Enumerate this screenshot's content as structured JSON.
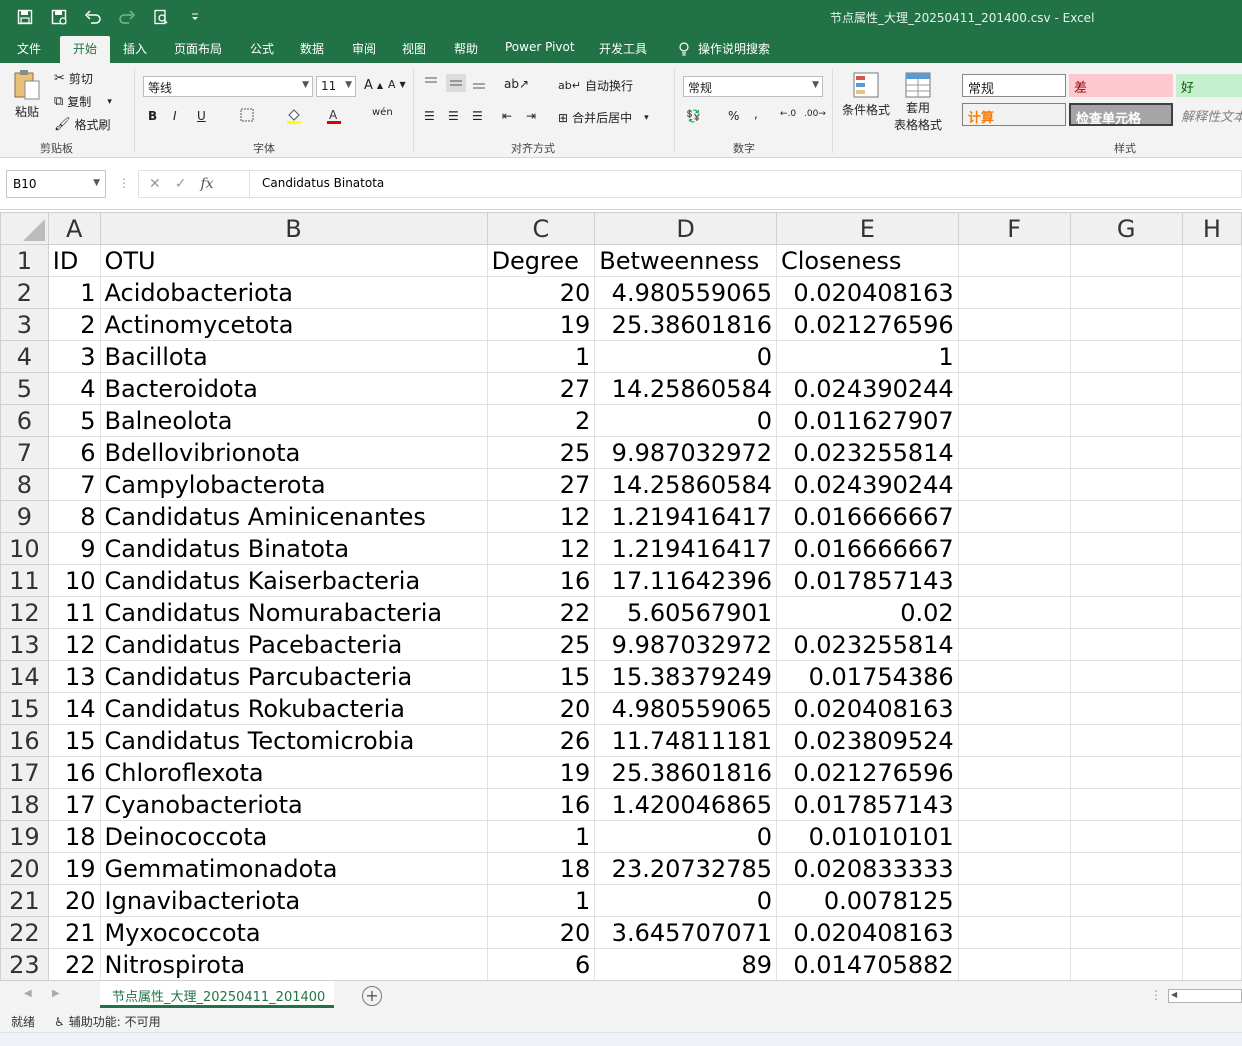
{
  "window": {
    "doc_title": "节点属性_大理_20250411_201400.csv  -  Excel"
  },
  "menu": {
    "items": [
      "文件",
      "开始",
      "插入",
      "页面布局",
      "公式",
      "数据",
      "审阅",
      "视图",
      "帮助",
      "Power Pivot",
      "开发工具",
      "操作说明搜索"
    ],
    "active": "开始"
  },
  "ribbon": {
    "clipboard": {
      "paste": "粘贴",
      "cut": "剪切",
      "copy": "复制",
      "format_painter": "格式刷",
      "label": "剪贴板"
    },
    "font": {
      "name": "等线",
      "size": "11",
      "label": "字体",
      "bold": "B",
      "italic": "I",
      "underline": "U"
    },
    "alignment": {
      "wrap": "自动换行",
      "merge": "合并后居中",
      "label": "对齐方式"
    },
    "number": {
      "format": "常规",
      "percent": "%",
      "comma": ",",
      "label": "数字"
    },
    "styles": {
      "conditional": "条件格式",
      "table_format_1": "套用",
      "table_format_2": "表格格式",
      "label": "样式",
      "normal": "常规",
      "bad": "差",
      "good": "好",
      "calc": "计算",
      "check": "检查单元格",
      "explain": "解释性文本"
    }
  },
  "formula_bar": {
    "name_box": "B10",
    "fx": "fx",
    "content": "Candidatus Binatota"
  },
  "columns": [
    "A",
    "B",
    "C",
    "D",
    "E",
    "F",
    "G",
    "H"
  ],
  "rows": [
    {
      "n": "1",
      "a": "ID",
      "b": "OTU",
      "c": "Degree",
      "d": "Betweenness",
      "e": "Closeness"
    },
    {
      "n": "2",
      "a": "1",
      "b": "Acidobacteriota",
      "c": "20",
      "d": "4.980559065",
      "e": "0.020408163"
    },
    {
      "n": "3",
      "a": "2",
      "b": "Actinomycetota",
      "c": "19",
      "d": "25.38601816",
      "e": "0.021276596"
    },
    {
      "n": "4",
      "a": "3",
      "b": "Bacillota",
      "c": "1",
      "d": "0",
      "e": "1"
    },
    {
      "n": "5",
      "a": "4",
      "b": "Bacteroidota",
      "c": "27",
      "d": "14.25860584",
      "e": "0.024390244"
    },
    {
      "n": "6",
      "a": "5",
      "b": "Balneolota",
      "c": "2",
      "d": "0",
      "e": "0.011627907"
    },
    {
      "n": "7",
      "a": "6",
      "b": "Bdellovibrionota",
      "c": "25",
      "d": "9.987032972",
      "e": "0.023255814"
    },
    {
      "n": "8",
      "a": "7",
      "b": "Campylobacterota",
      "c": "27",
      "d": "14.25860584",
      "e": "0.024390244"
    },
    {
      "n": "9",
      "a": "8",
      "b": "Candidatus Aminicenantes",
      "c": "12",
      "d": "1.219416417",
      "e": "0.016666667"
    },
    {
      "n": "10",
      "a": "9",
      "b": "Candidatus Binatota",
      "c": "12",
      "d": "1.219416417",
      "e": "0.016666667"
    },
    {
      "n": "11",
      "a": "10",
      "b": "Candidatus Kaiserbacteria",
      "c": "16",
      "d": "17.11642396",
      "e": "0.017857143"
    },
    {
      "n": "12",
      "a": "11",
      "b": "Candidatus Nomurabacteria",
      "c": "22",
      "d": "5.60567901",
      "e": "0.02"
    },
    {
      "n": "13",
      "a": "12",
      "b": "Candidatus Pacebacteria",
      "c": "25",
      "d": "9.987032972",
      "e": "0.023255814"
    },
    {
      "n": "14",
      "a": "13",
      "b": "Candidatus Parcubacteria",
      "c": "15",
      "d": "15.38379249",
      "e": "0.01754386"
    },
    {
      "n": "15",
      "a": "14",
      "b": "Candidatus Rokubacteria",
      "c": "20",
      "d": "4.980559065",
      "e": "0.020408163"
    },
    {
      "n": "16",
      "a": "15",
      "b": "Candidatus Tectomicrobia",
      "c": "26",
      "d": "11.74811181",
      "e": "0.023809524"
    },
    {
      "n": "17",
      "a": "16",
      "b": "Chloroflexota",
      "c": "19",
      "d": "25.38601816",
      "e": "0.021276596"
    },
    {
      "n": "18",
      "a": "17",
      "b": "Cyanobacteriota",
      "c": "16",
      "d": "1.420046865",
      "e": "0.017857143"
    },
    {
      "n": "19",
      "a": "18",
      "b": "Deinococcota",
      "c": "1",
      "d": "0",
      "e": "0.01010101"
    },
    {
      "n": "20",
      "a": "19",
      "b": "Gemmatimonadota",
      "c": "18",
      "d": "23.20732785",
      "e": "0.020833333"
    },
    {
      "n": "21",
      "a": "20",
      "b": "Ignavibacteriota",
      "c": "1",
      "d": "0",
      "e": "0.0078125"
    },
    {
      "n": "22",
      "a": "21",
      "b": "Myxococcota",
      "c": "20",
      "d": "3.645707071",
      "e": "0.020408163"
    },
    {
      "n": "23",
      "a": "22",
      "b": "Nitrospirota",
      "c": "6",
      "d": "89",
      "e": "0.014705882"
    }
  ],
  "sheet_tab": "节点属性_大理_20250411_201400",
  "status": {
    "ready": "就绪",
    "accessibility": "辅助功能: 不可用"
  },
  "colors": {
    "excel_green": "#217346",
    "bad_bg": "#ffc7ce",
    "bad_fg": "#9c0006",
    "good_bg": "#c6efce",
    "good_fg": "#006100",
    "calc_fg": "#fa7d00",
    "check_bg": "#a5a5a5"
  }
}
